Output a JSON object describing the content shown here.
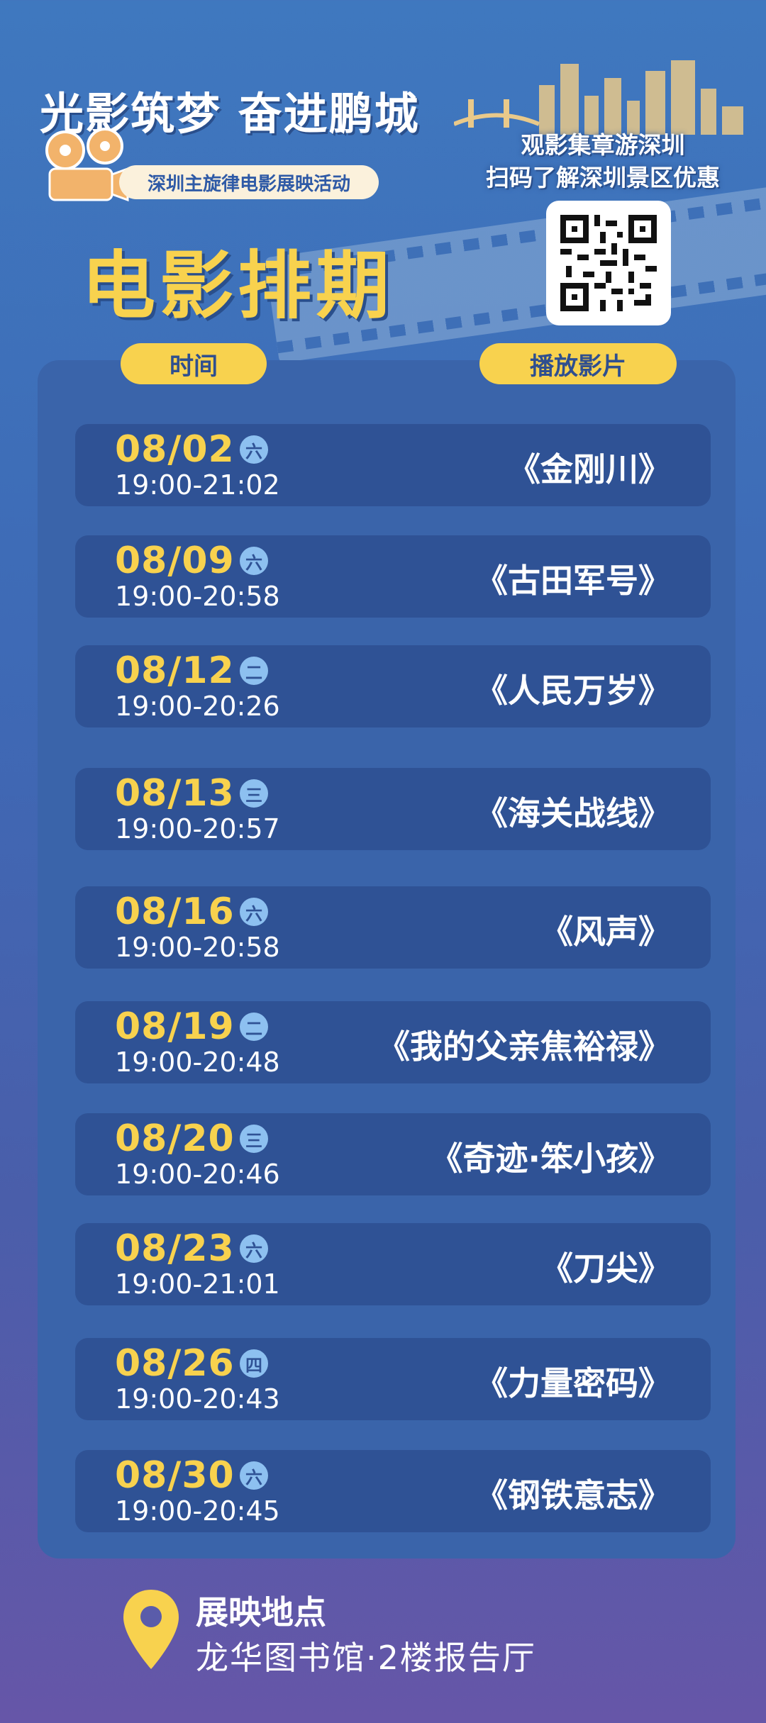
{
  "header": {
    "slogan": "光影筑梦 奋进鹏城",
    "subtitle": "深圳主旋律电影展映活动",
    "title": "电影排期"
  },
  "promo": {
    "line1": "观影集章游深圳",
    "line2": "扫码了解深圳景区优惠"
  },
  "columns": {
    "time": "时间",
    "film": "播放影片"
  },
  "schedule": [
    {
      "date": "08/02",
      "dow": "六",
      "time": "19:00-21:02",
      "film": "《金刚川》"
    },
    {
      "date": "08/09",
      "dow": "六",
      "time": "19:00-20:58",
      "film": "《古田军号》"
    },
    {
      "date": "08/12",
      "dow": "二",
      "time": "19:00-20:26",
      "film": "《人民万岁》"
    },
    {
      "date": "08/13",
      "dow": "三",
      "time": "19:00-20:57",
      "film": "《海关战线》"
    },
    {
      "date": "08/16",
      "dow": "六",
      "time": "19:00-20:58",
      "film": "《风声》"
    },
    {
      "date": "08/19",
      "dow": "二",
      "time": "19:00-20:48",
      "film": "《我的父亲焦裕禄》"
    },
    {
      "date": "08/20",
      "dow": "三",
      "time": "19:00-20:46",
      "film": "《奇迹·笨小孩》"
    },
    {
      "date": "08/23",
      "dow": "六",
      "time": "19:00-21:01",
      "film": "《刀尖》"
    },
    {
      "date": "08/26",
      "dow": "四",
      "time": "19:00-20:43",
      "film": "《力量密码》"
    },
    {
      "date": "08/30",
      "dow": "六",
      "time": "19:00-20:45",
      "film": "《钢铁意志》"
    }
  ],
  "venue": {
    "label": "展映地点",
    "name": "龙华图书馆·2楼报告厅"
  },
  "colors": {
    "accent_yellow": "#f8d24e",
    "panel_blue": "#3a64aa",
    "row_blue": "#2f5295",
    "weekday_badge": "#8dc0f0"
  },
  "icons": {
    "camera": "film-camera-icon",
    "qr": "qr-code-icon",
    "pin": "location-pin-icon",
    "skyline": "city-skyline-icon"
  }
}
